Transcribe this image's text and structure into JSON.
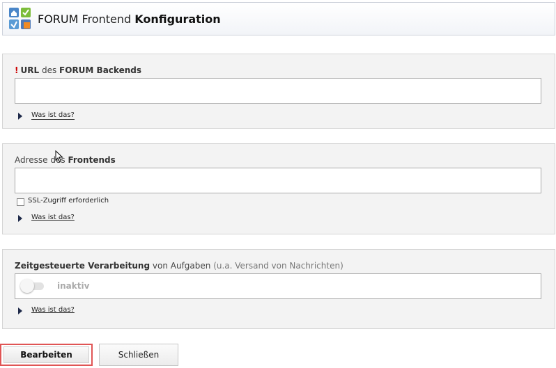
{
  "header": {
    "icon": "forum-app-icon",
    "title_part1": "FORUM",
    "title_part2": "Frontend",
    "title_part3": "Konfiguration"
  },
  "sections": {
    "backend_url": {
      "required_mark": "!",
      "label_strong_1": "URL",
      "label_normal": "des",
      "label_strong_2": "FORUM Backends",
      "value": "",
      "help_link": "Was ist das?"
    },
    "frontend_address": {
      "label_normal": "Adresse des",
      "label_strong": "Frontends",
      "value": "",
      "checkbox_label": "SSL-Zugriff erforderlich",
      "checkbox_checked": false,
      "help_link": "Was ist das?"
    },
    "scheduled_processing": {
      "label_strong": "Zeitgesteuerte Verarbeitung",
      "label_normal": "von Aufgaben",
      "label_hint": "(u.a. Versand von Nachrichten)",
      "toggle_state": "inaktiv",
      "toggle_on": false,
      "help_link": "Was ist das?"
    }
  },
  "buttons": {
    "edit": "Bearbeiten",
    "close": "Schließen"
  },
  "colors": {
    "required": "#cc0000",
    "panel_bg": "#f3f3f3",
    "highlight_border": "#e05555"
  }
}
